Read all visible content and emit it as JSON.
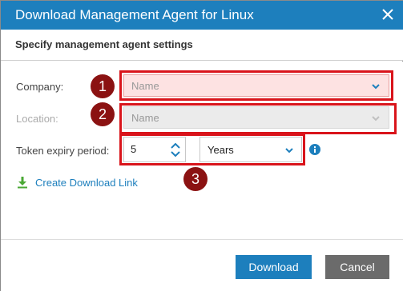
{
  "dialog": {
    "title": "Download Management Agent for Linux",
    "subtitle": "Specify management agent settings"
  },
  "form": {
    "company": {
      "label": "Company:",
      "placeholder": "Name",
      "state": "error"
    },
    "location": {
      "label": "Location:",
      "placeholder": "Name",
      "state": "disabled"
    },
    "token_expiry": {
      "label": "Token expiry period:",
      "value": "5",
      "unit": "Years"
    }
  },
  "link": {
    "label": "Create Download Link"
  },
  "buttons": {
    "download": "Download",
    "cancel": "Cancel"
  },
  "markers": [
    "1",
    "2",
    "3"
  ],
  "colors": {
    "title_bar": "#1d7fbd",
    "primary_button": "#1d7fbd",
    "secondary_button": "#6b6b6b",
    "highlight": "#d9141b",
    "marker": "#8b1212",
    "error_field": "#fde2e2",
    "link_icon": "#4aa834"
  },
  "icons": {
    "close": "close-icon",
    "chevron": "chevron-down-icon",
    "stepper_up": "chevron-up-icon",
    "stepper_down": "chevron-down-icon",
    "info": "info-icon",
    "download": "download-icon"
  }
}
